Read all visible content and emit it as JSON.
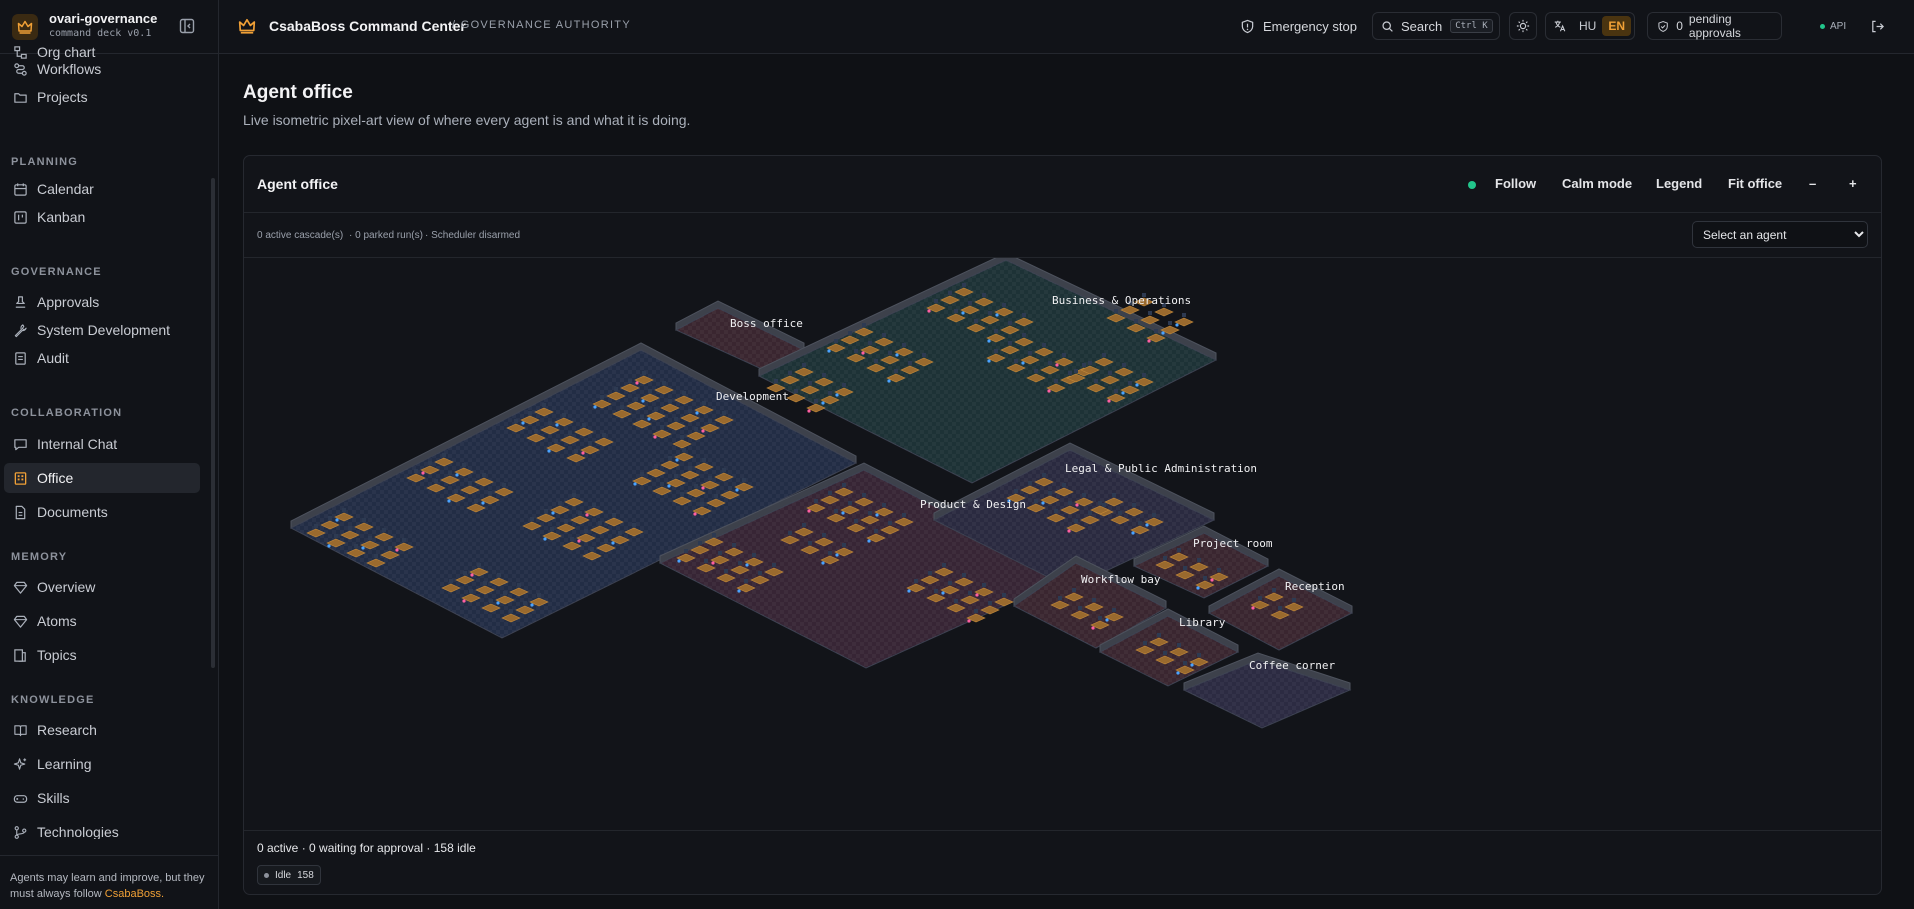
{
  "brand": {
    "name": "ovari-governance",
    "subtitle": "command deck v0.1"
  },
  "sidebar": {
    "items_top": [
      {
        "label": "Org chart",
        "icon": "org-chart-icon"
      },
      {
        "label": "Workflows",
        "icon": "workflow-icon"
      },
      {
        "label": "Projects",
        "icon": "folder-icon"
      }
    ],
    "groups": [
      {
        "title": "PLANNING",
        "items": [
          {
            "label": "Calendar",
            "icon": "calendar-icon"
          },
          {
            "label": "Kanban",
            "icon": "kanban-icon"
          }
        ]
      },
      {
        "title": "GOVERNANCE",
        "items": [
          {
            "label": "Approvals",
            "icon": "stamp-icon"
          },
          {
            "label": "System Development",
            "icon": "wrench-icon"
          },
          {
            "label": "Audit",
            "icon": "audit-icon"
          }
        ]
      },
      {
        "title": "COLLABORATION",
        "items": [
          {
            "label": "Internal Chat",
            "icon": "chat-icon"
          },
          {
            "label": "Office",
            "icon": "building-icon",
            "active": true
          },
          {
            "label": "Documents",
            "icon": "document-icon"
          }
        ]
      },
      {
        "title": "MEMORY",
        "items": [
          {
            "label": "Overview",
            "icon": "gem-icon"
          },
          {
            "label": "Atoms",
            "icon": "gem-icon"
          },
          {
            "label": "Topics",
            "icon": "topics-icon"
          }
        ]
      },
      {
        "title": "KNOWLEDGE",
        "items": [
          {
            "label": "Research",
            "icon": "book-icon"
          },
          {
            "label": "Learning",
            "icon": "sparkle-icon"
          },
          {
            "label": "Skills",
            "icon": "gamepad-icon"
          },
          {
            "label": "Technologies",
            "icon": "git-branch-icon"
          }
        ]
      }
    ],
    "footer_text": "Agents may learn and improve, but they must always follow ",
    "footer_highlight": "CsabaBoss."
  },
  "topbar": {
    "title": "CsabaBoss Command Center",
    "crumb": "/ GOVERNANCE AUTHORITY",
    "emergency": "Emergency stop",
    "search": "Search",
    "search_kbd": "Ctrl K",
    "lang_hu": "HU",
    "lang_en": "EN",
    "pending_count": "0",
    "pending_label": "pending approvals",
    "api": "API"
  },
  "page": {
    "title": "Agent office",
    "subtitle": "Live isometric pixel-art view of where every agent is and what it is doing."
  },
  "office": {
    "card_title": "Agent office",
    "controls": {
      "follow": "Follow",
      "calm": "Calm mode",
      "legend": "Legend",
      "fit": "Fit office",
      "zoom_out": "–",
      "zoom_in": "+"
    },
    "stats": {
      "cascades": "0 active cascade(s)",
      "parked": "· 0 parked run(s)",
      "scheduler": "· Scheduler disarmed"
    },
    "agent_select": "Select an agent",
    "rooms": [
      {
        "name": "Boss office"
      },
      {
        "name": "Business & Operations"
      },
      {
        "name": "Development"
      },
      {
        "name": "Legal & Public Administration"
      },
      {
        "name": "Product & Design"
      },
      {
        "name": "Project room"
      },
      {
        "name": "Workflow bay"
      },
      {
        "name": "Reception"
      },
      {
        "name": "Library"
      },
      {
        "name": "Coffee corner"
      }
    ],
    "footer_status": "0 active · 0 waiting for approval · 158 idle",
    "idle_label": "Idle",
    "idle_count": "158"
  }
}
